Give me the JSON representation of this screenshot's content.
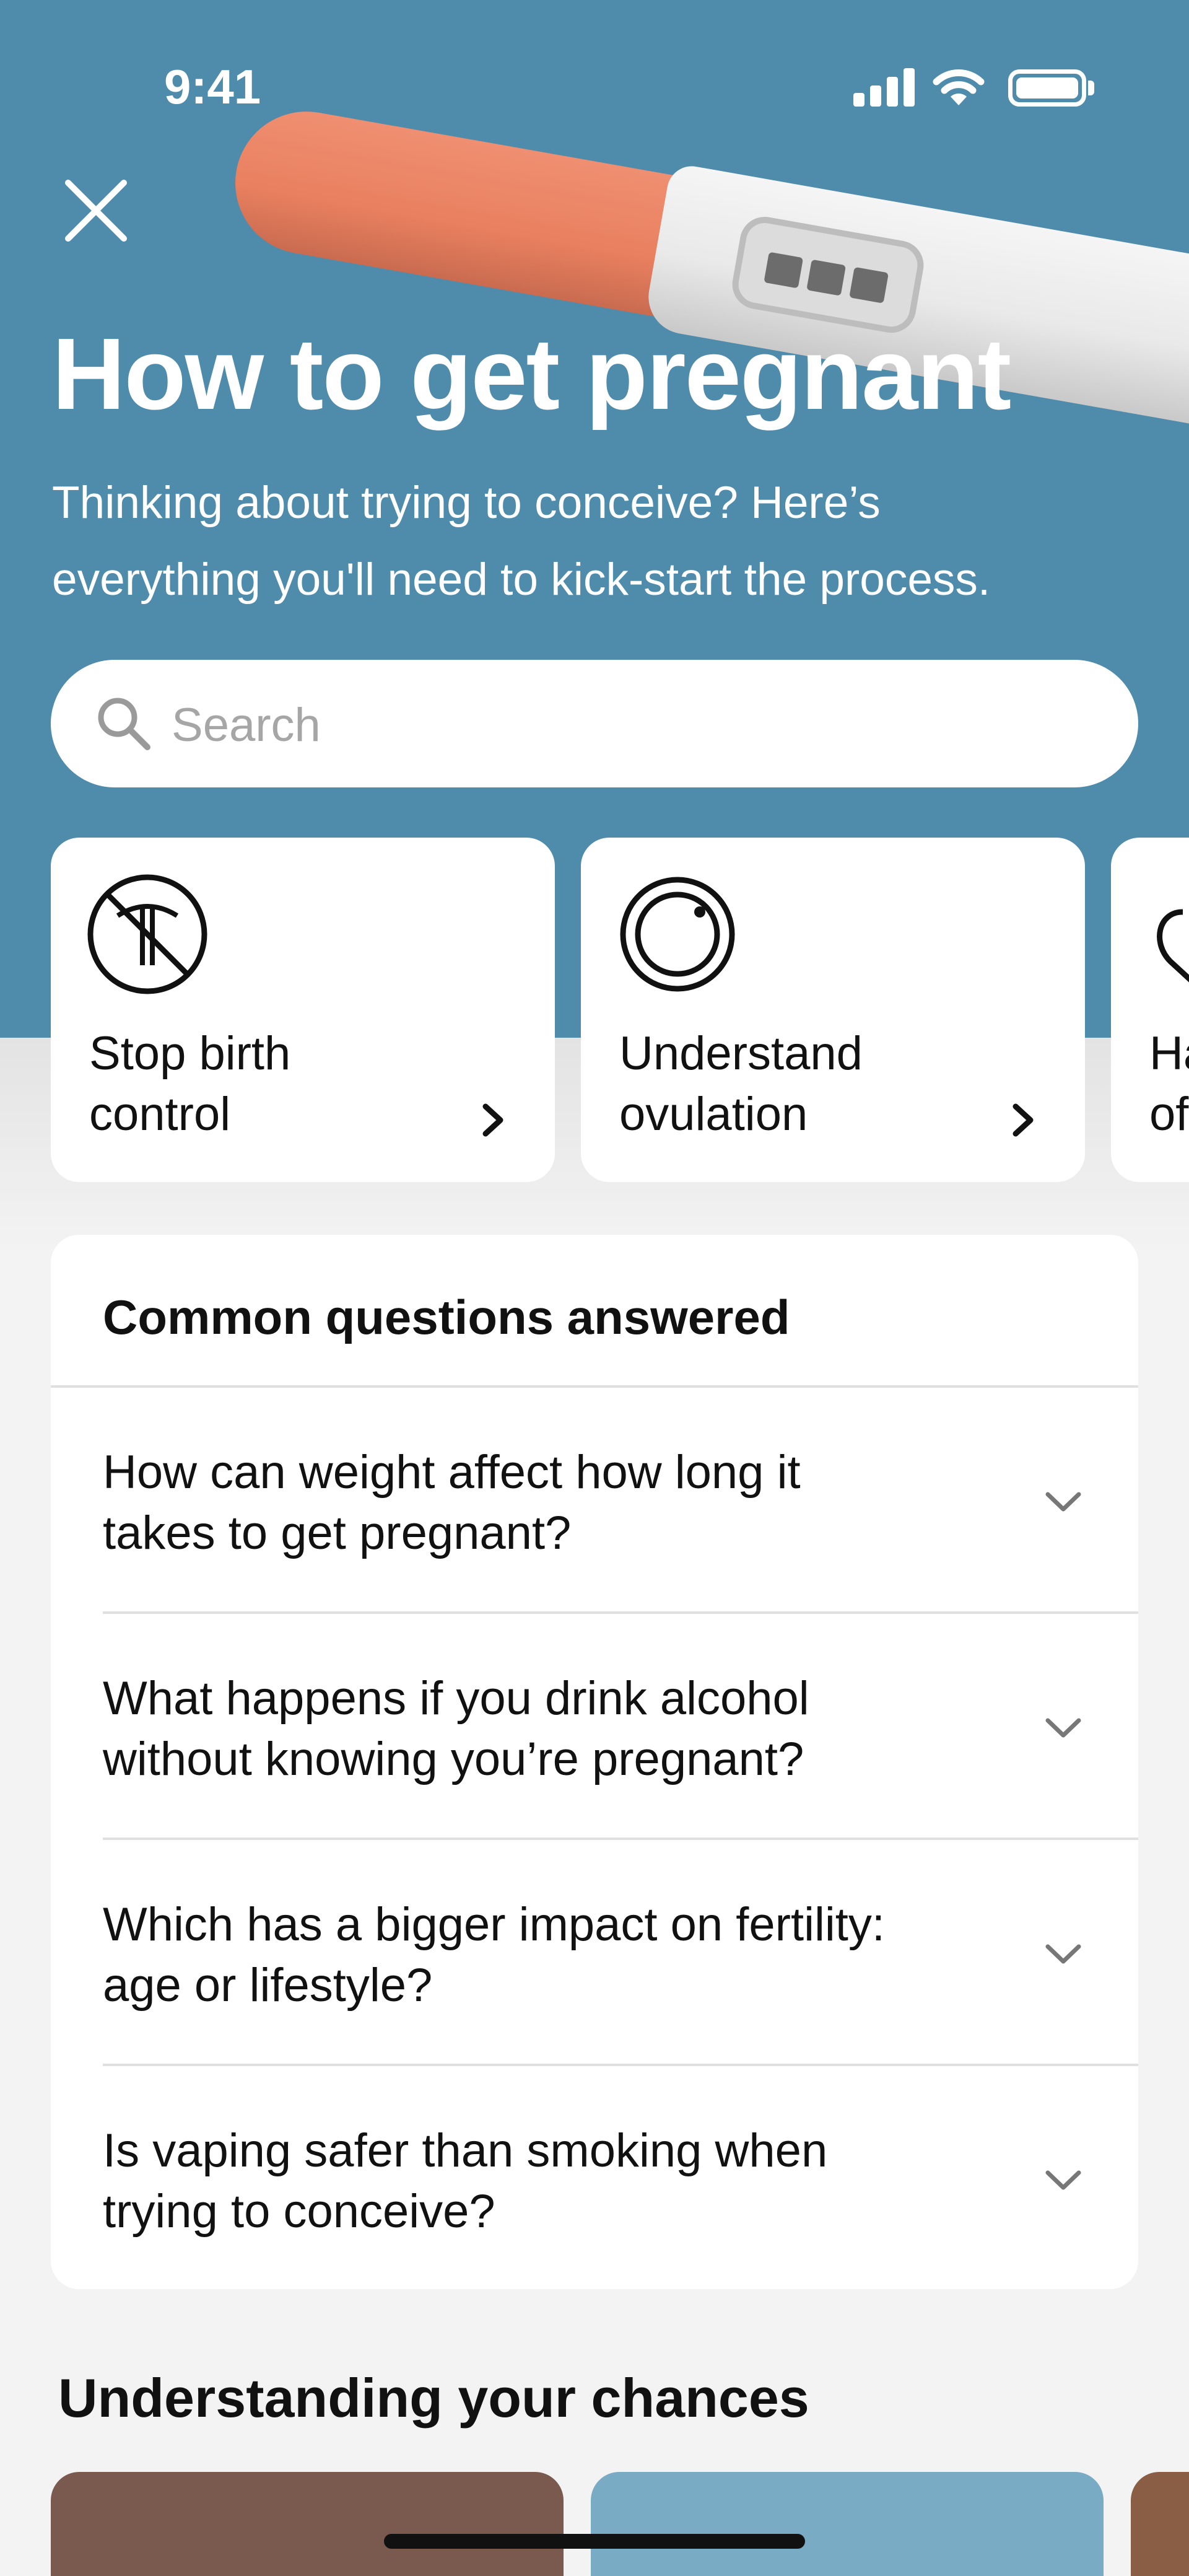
{
  "status_bar": {
    "time": "9:41"
  },
  "header": {
    "title": "How to get pregnant",
    "subtitle_line1": "Thinking about trying to conceive? Here’s",
    "subtitle_line2": "everything you'll need to kick-start the process."
  },
  "search": {
    "placeholder": "Search"
  },
  "cards": [
    {
      "label_line1": "Stop birth",
      "label_line2": "control",
      "icon": "no-iud-icon"
    },
    {
      "label_line1": "Understand",
      "label_line2": "ovulation",
      "icon": "ovulation-circle-icon"
    },
    {
      "label_line1": "Ha",
      "label_line2": "of",
      "icon": "heart-icon"
    }
  ],
  "faq": {
    "title": "Common questions answered",
    "items": [
      {
        "line1": "How can weight affect how long it",
        "line2": "takes to get pregnant?"
      },
      {
        "line1": "What happens if you drink alcohol",
        "line2": "without knowing you’re pregnant?"
      },
      {
        "line1": "Which has a bigger impact on fertility:",
        "line2": "age or lifestyle?"
      },
      {
        "line1": "Is vaping safer than smoking when",
        "line2": "trying to conceive?"
      }
    ]
  },
  "section": {
    "title": "Understanding your chances"
  },
  "colors": {
    "hero": "#4f8cab",
    "background": "#f3f3f3",
    "thumb1": "#7a5a4e",
    "thumb2": "#7aabc4",
    "thumb3": "#8a5e44"
  }
}
